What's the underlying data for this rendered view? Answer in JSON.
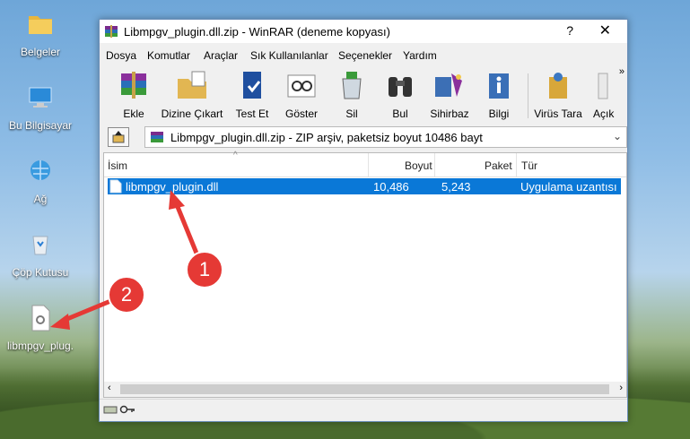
{
  "desktop": {
    "icons": [
      {
        "label": "Belgeler"
      },
      {
        "label": "Bu Bilgisayar"
      },
      {
        "label": "Ağ"
      },
      {
        "label": "Çöp Kutusu"
      },
      {
        "label": "libmpgv_plug."
      }
    ]
  },
  "window": {
    "title": "Libmpgv_plugin.dll.zip - WinRAR (deneme kopyası)",
    "help": "?",
    "close": "✕"
  },
  "menu": [
    "Dosya",
    "Komutlar",
    "Araçlar",
    "Sık Kullanılanlar",
    "Seçenekler",
    "Yardım"
  ],
  "toolbar": [
    "Ekle",
    "Dizine Çıkart",
    "Test Et",
    "Göster",
    "Sil",
    "Bul",
    "Sihirbaz",
    "Bilgi",
    "Virüs Tara",
    "Açık"
  ],
  "toolbar_overflow": "»",
  "address": {
    "text": "Libmpgv_plugin.dll.zip - ZIP arşiv, paketsiz boyut 10486 bayt"
  },
  "list": {
    "columns": [
      "İsim",
      "Boyut",
      "Paket",
      "Tür"
    ],
    "rows": [
      {
        "name": "libmpgv_plugin.dll",
        "size": "10,486",
        "packed": "5,243",
        "type": "Uygulama uzantısı"
      }
    ]
  },
  "annotations": [
    "1",
    "2"
  ],
  "colors": {
    "selection": "#0a78d7",
    "badge": "#e53935"
  }
}
